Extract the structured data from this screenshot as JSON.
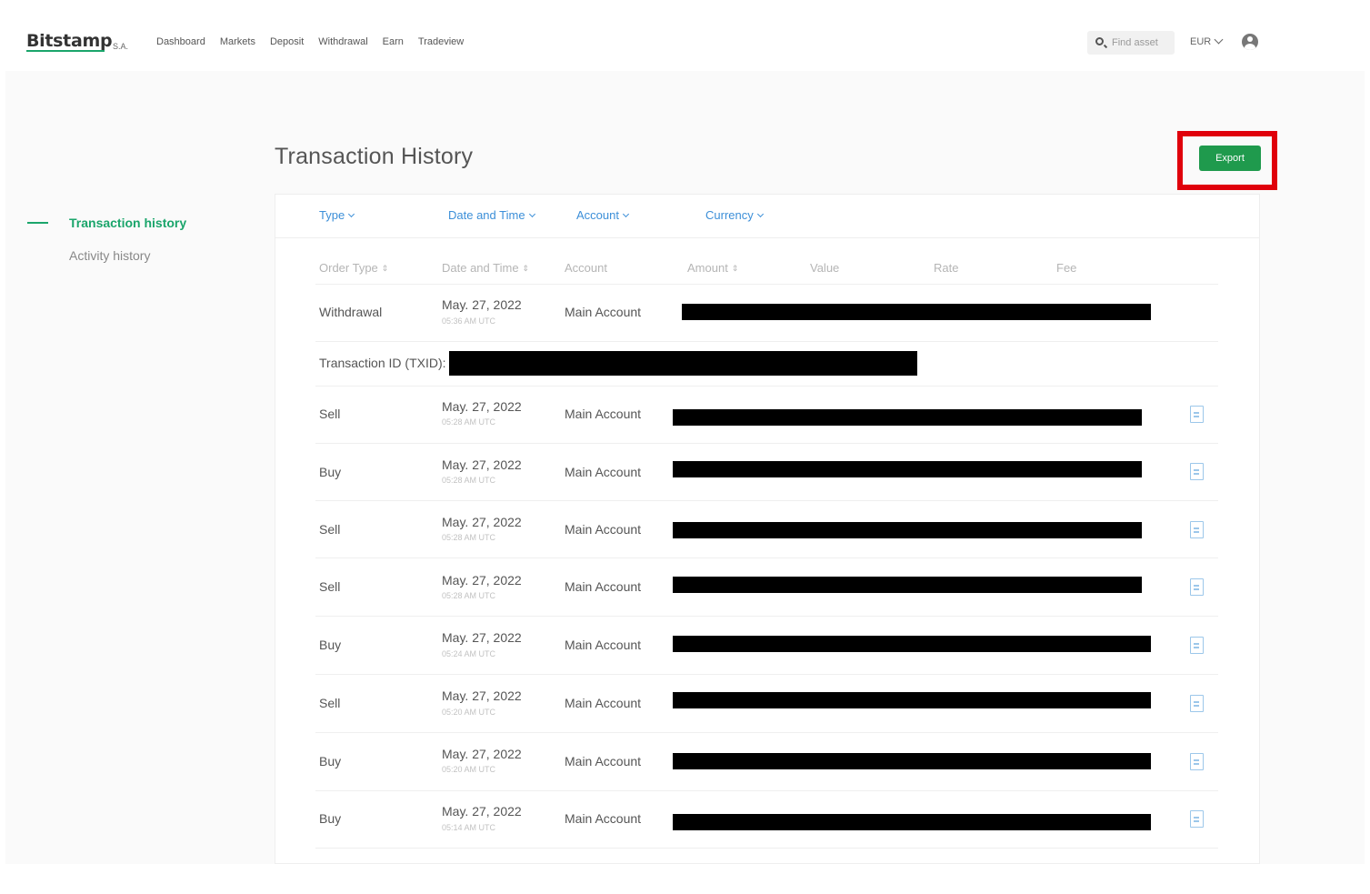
{
  "header": {
    "logo": "Bitstamp",
    "logo_suffix": "S.A.",
    "nav": [
      "Dashboard",
      "Markets",
      "Deposit",
      "Withdrawal",
      "Earn",
      "Tradeview"
    ],
    "search_placeholder": "Find asset",
    "currency": "EUR"
  },
  "page": {
    "title": "Transaction History",
    "export_label": "Export"
  },
  "sidebar": {
    "items": [
      {
        "label": "Transaction history",
        "active": true
      },
      {
        "label": "Activity history",
        "active": false
      }
    ]
  },
  "filters": [
    "Type",
    "Date and Time",
    "Account",
    "Currency"
  ],
  "columns": [
    "Order Type",
    "Date and Time",
    "Account",
    "Amount",
    "Value",
    "Rate",
    "Fee"
  ],
  "txid_label": "Transaction ID (TXID):",
  "rows": [
    {
      "type": "Withdrawal",
      "date": "May. 27, 2022",
      "time": "05:36 AM UTC",
      "account": "Main Account"
    },
    {
      "type": "Sell",
      "date": "May. 27, 2022",
      "time": "05:28 AM UTC",
      "account": "Main Account"
    },
    {
      "type": "Buy",
      "date": "May. 27, 2022",
      "time": "05:28 AM UTC",
      "account": "Main Account"
    },
    {
      "type": "Sell",
      "date": "May. 27, 2022",
      "time": "05:28 AM UTC",
      "account": "Main Account"
    },
    {
      "type": "Sell",
      "date": "May. 27, 2022",
      "time": "05:28 AM UTC",
      "account": "Main Account"
    },
    {
      "type": "Buy",
      "date": "May. 27, 2022",
      "time": "05:24 AM UTC",
      "account": "Main Account"
    },
    {
      "type": "Sell",
      "date": "May. 27, 2022",
      "time": "05:20 AM UTC",
      "account": "Main Account"
    },
    {
      "type": "Buy",
      "date": "May. 27, 2022",
      "time": "05:20 AM UTC",
      "account": "Main Account"
    },
    {
      "type": "Buy",
      "date": "May. 27, 2022",
      "time": "05:14 AM UTC",
      "account": "Main Account"
    }
  ],
  "colors": {
    "brand_green": "#1aa56b",
    "export_green": "#1f9a4d",
    "link_blue": "#3c8fd8",
    "highlight_red": "#e0000b"
  },
  "icons": [
    "search-icon",
    "chevron-down-icon",
    "user-icon",
    "sort-icon",
    "document-icon"
  ]
}
